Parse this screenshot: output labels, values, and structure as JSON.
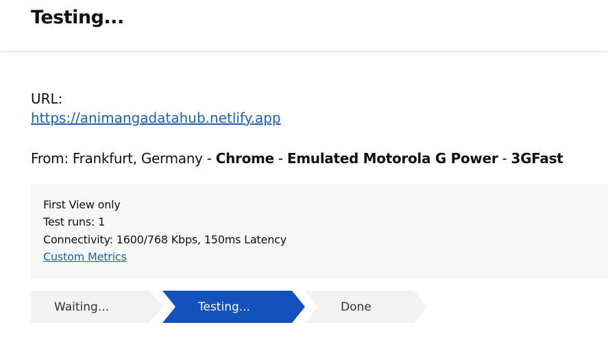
{
  "header": {
    "title": "Testing..."
  },
  "test": {
    "url_label": "URL:",
    "url": "https://animangadatahub.netlify.app",
    "from_prefix": "From: Frankfurt, Germany - ",
    "browser": "Chrome",
    "sep1": " - ",
    "device": "Emulated Motorola G Power",
    "sep2": " - ",
    "connection": "3GFast"
  },
  "info": {
    "view": "First View only",
    "runs": "Test runs: 1",
    "connectivity": "Connectivity: 1600/768 Kbps, 150ms Latency",
    "custom_metrics": "Custom Metrics"
  },
  "steps": [
    {
      "label": "Waiting...",
      "state": "done"
    },
    {
      "label": "Testing...",
      "state": "active"
    },
    {
      "label": "Done",
      "state": "pending"
    }
  ],
  "colors": {
    "accent": "#1252bc",
    "link": "#1a5fc4",
    "step_inactive": "#f2f2f2"
  }
}
